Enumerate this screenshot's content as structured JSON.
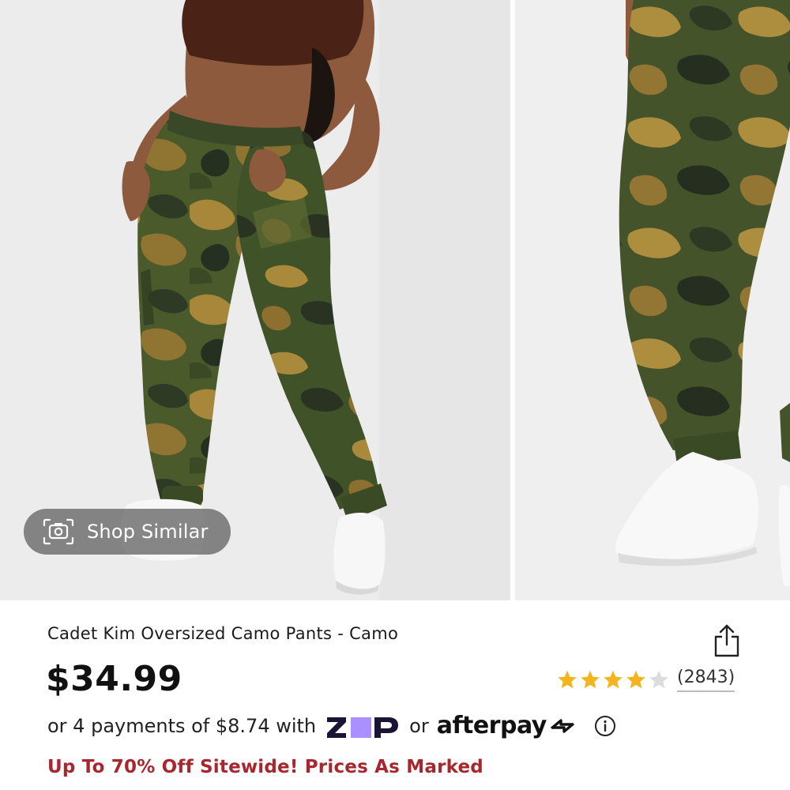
{
  "gallery": {
    "shop_similar_label": "Shop Similar"
  },
  "product": {
    "title": "Cadet Kim Oversized Camo Pants - Camo",
    "price": "$34.99",
    "rating": 4,
    "rating_max": 5,
    "review_count": "(2843)"
  },
  "payments": {
    "prefix": "or 4 payments of $8.74 with",
    "zip_label": "Zip",
    "or": "or",
    "afterpay_label": "afterpay"
  },
  "promo": {
    "text": "Up To 70% Off Sitewide! Prices As Marked"
  },
  "colors": {
    "promo": "#a8262d",
    "star_filled": "#f2b51d",
    "star_empty": "#dcdcdc"
  },
  "icons": {
    "share": "share-icon",
    "camera": "camera-icon",
    "info": "info-icon"
  }
}
